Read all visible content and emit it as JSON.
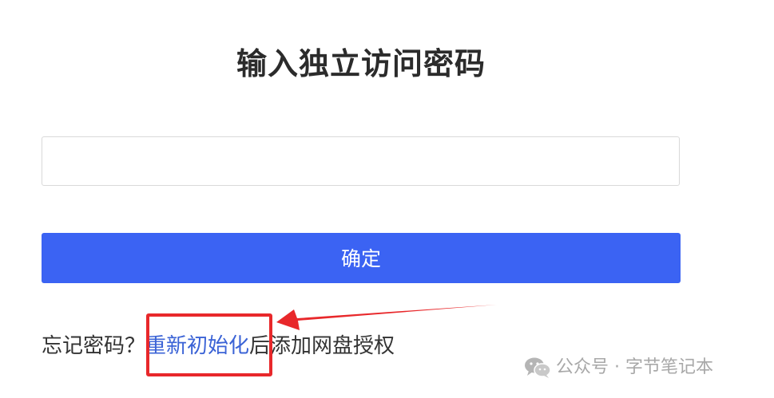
{
  "page": {
    "title": "输入独立访问密码"
  },
  "form": {
    "password_value": "",
    "password_placeholder": "",
    "confirm_label": "确定"
  },
  "forgot": {
    "prefix": "忘记密码？",
    "reset_link": "重新初始化",
    "suffix": "后添加网盘授权"
  },
  "watermark": {
    "text": "公众号 · 字节笔记本"
  },
  "colors": {
    "primary": "#3b63f3",
    "link": "#3b63d6",
    "annotation": "#e8282b"
  }
}
